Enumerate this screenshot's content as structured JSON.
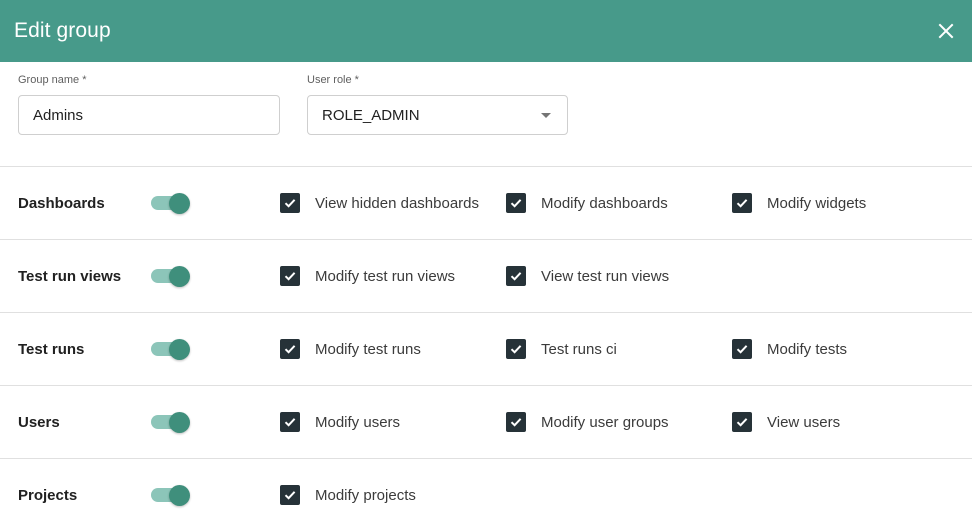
{
  "dialog": {
    "title": "Edit group"
  },
  "icons": {
    "close": "close-icon",
    "dropdown": "caret-down-icon",
    "checkbox": "check-icon"
  },
  "colors": {
    "header": "#479a8a",
    "toggle_thumb": "#3f8f7c",
    "toggle_track": "#8cc5b9",
    "checkbox": "#263238"
  },
  "form": {
    "group_name": {
      "label": "Group name *",
      "value": "Admins"
    },
    "user_role": {
      "label": "User role *",
      "value": "ROLE_ADMIN"
    }
  },
  "groups": [
    {
      "label": "Dashboards",
      "enabled": true,
      "permissions": [
        {
          "label": "View hidden dashboards",
          "checked": true
        },
        {
          "label": "Modify dashboards",
          "checked": true
        },
        {
          "label": "Modify widgets",
          "checked": true
        }
      ]
    },
    {
      "label": "Test run views",
      "enabled": true,
      "permissions": [
        {
          "label": "Modify test run views",
          "checked": true
        },
        {
          "label": "View test run views",
          "checked": true
        }
      ]
    },
    {
      "label": "Test runs",
      "enabled": true,
      "permissions": [
        {
          "label": "Modify test runs",
          "checked": true
        },
        {
          "label": "Test runs ci",
          "checked": true
        },
        {
          "label": "Modify tests",
          "checked": true
        }
      ]
    },
    {
      "label": "Users",
      "enabled": true,
      "permissions": [
        {
          "label": "Modify users",
          "checked": true
        },
        {
          "label": "Modify user groups",
          "checked": true
        },
        {
          "label": "View users",
          "checked": true
        }
      ]
    },
    {
      "label": "Projects",
      "enabled": true,
      "permissions": [
        {
          "label": "Modify projects",
          "checked": true
        }
      ]
    }
  ]
}
